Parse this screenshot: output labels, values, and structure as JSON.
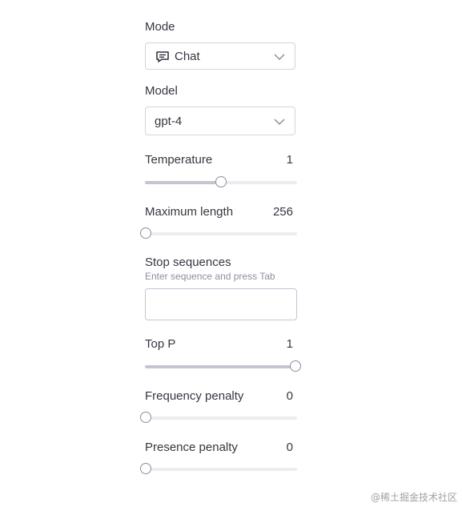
{
  "mode": {
    "label": "Mode",
    "selected": "Chat",
    "icon": "chat-icon"
  },
  "model": {
    "label": "Model",
    "selected": "gpt-4"
  },
  "temperature": {
    "label": "Temperature",
    "value": "1",
    "fraction": 0.5
  },
  "max_length": {
    "label": "Maximum length",
    "value": "256",
    "fraction": 0.0
  },
  "stop_sequences": {
    "label": "Stop sequences",
    "hint": "Enter sequence and press Tab",
    "value": ""
  },
  "top_p": {
    "label": "Top P",
    "value": "1",
    "fraction": 1.0
  },
  "frequency_penalty": {
    "label": "Frequency penalty",
    "value": "0",
    "fraction": 0.0
  },
  "presence_penalty": {
    "label": "Presence penalty",
    "value": "0",
    "fraction": 0.0
  },
  "watermark": "@稀土掘金技术社区"
}
